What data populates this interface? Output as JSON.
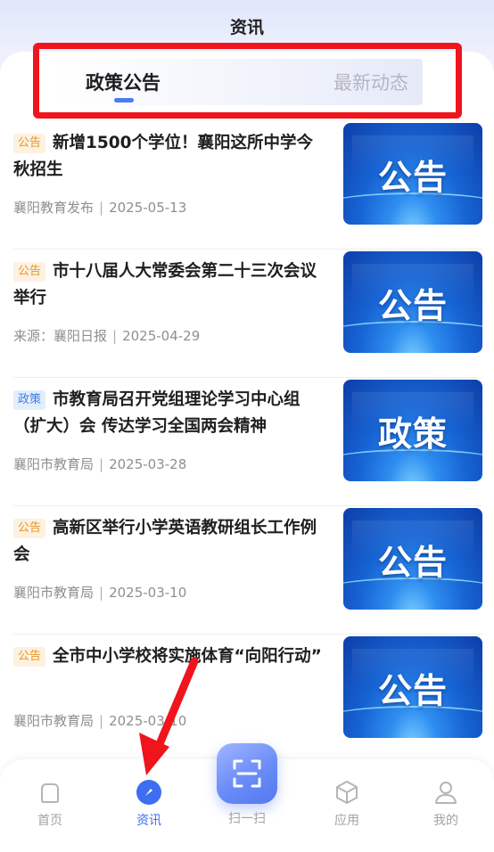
{
  "header": {
    "title": "资讯"
  },
  "tabs": [
    {
      "label": "政策公告",
      "active": true
    },
    {
      "label": "最新动态",
      "active": false
    }
  ],
  "news": [
    {
      "tag": "公告",
      "tag_type": "notice",
      "title": "新增1500个学位！襄阳这所中学今秋招生",
      "source": "襄阳教育发布",
      "date": "2025-05-13",
      "thumb_text": "公告"
    },
    {
      "tag": "公告",
      "tag_type": "notice",
      "title": "市十八届人大常委会第二十三次会议举行",
      "source": "来源：襄阳日报",
      "date": "2025-04-29",
      "thumb_text": "公告"
    },
    {
      "tag": "政策",
      "tag_type": "policy",
      "title": "市教育局召开党组理论学习中心组（扩大）会 传达学习全国两会精神",
      "source": "襄阳市教育局",
      "date": "2025-03-28",
      "thumb_text": "政策"
    },
    {
      "tag": "公告",
      "tag_type": "notice",
      "title": "高新区举行小学英语教研组长工作例会",
      "source": "襄阳市教育局",
      "date": "2025-03-10",
      "thumb_text": "公告"
    },
    {
      "tag": "公告",
      "tag_type": "notice",
      "title": "全市中小学校将实施体育“向阳行动”",
      "source": "襄阳市教育局",
      "date": "2025-03-10",
      "thumb_text": "公告"
    }
  ],
  "bottom_nav": {
    "home": "首页",
    "news": "资讯",
    "scan": "扫一扫",
    "apps": "应用",
    "mine": "我的"
  },
  "colors": {
    "accent": "#3d6ef2",
    "highlight": "#f0141c",
    "notice_tag": "#e8961d",
    "policy_tag": "#3e7ee6"
  },
  "icons": {
    "home": "home-icon",
    "news": "compass-icon",
    "scan": "scan-icon",
    "apps": "cube-icon",
    "mine": "user-icon"
  }
}
